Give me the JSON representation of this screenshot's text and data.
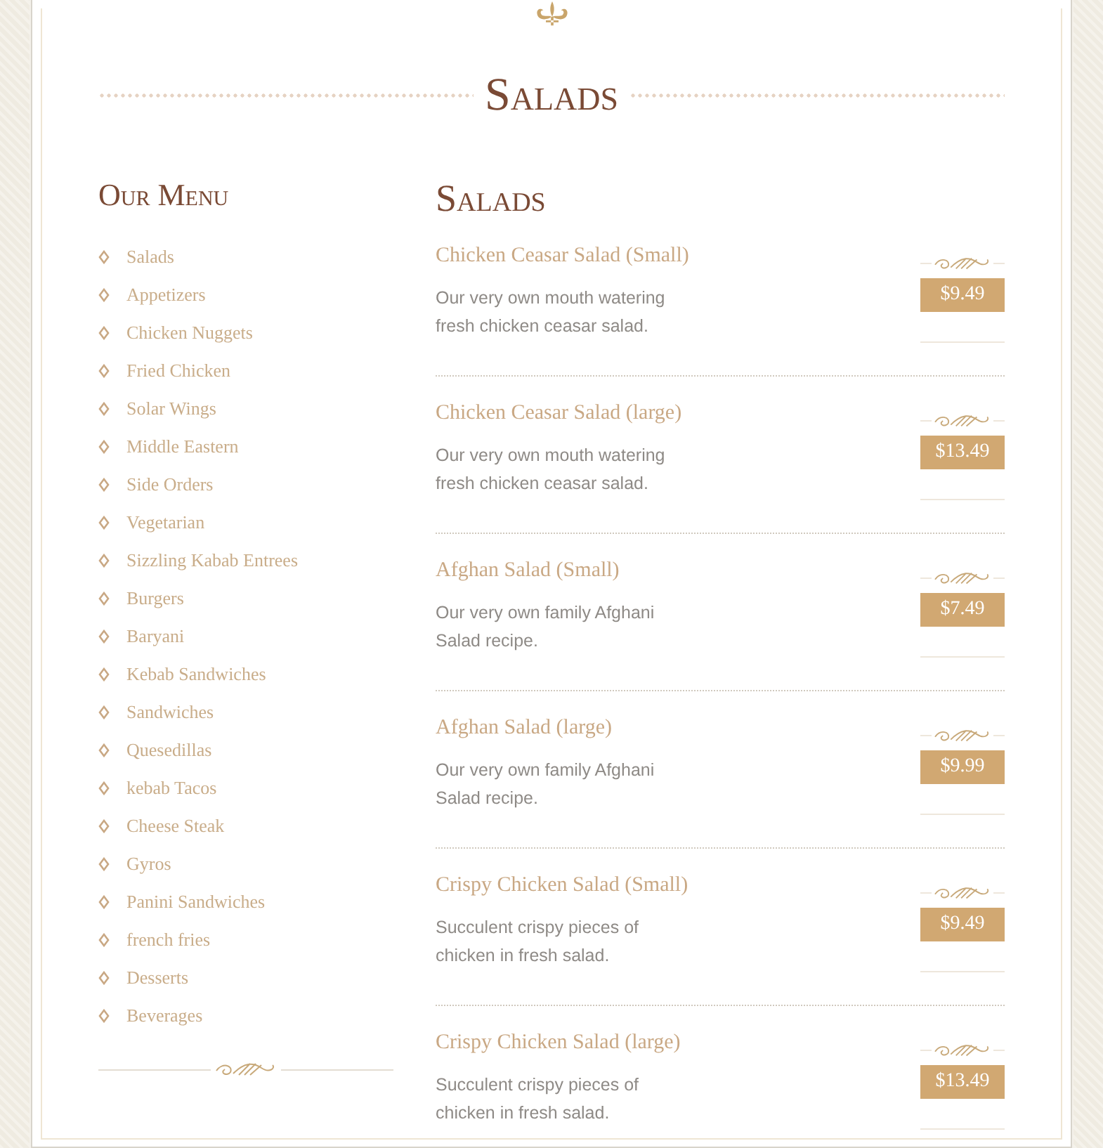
{
  "page_title": "Salads",
  "sidebar": {
    "title": "Our Menu",
    "items": [
      {
        "label": "Salads"
      },
      {
        "label": "Appetizers"
      },
      {
        "label": "Chicken Nuggets"
      },
      {
        "label": "Fried Chicken"
      },
      {
        "label": "Solar Wings"
      },
      {
        "label": "Middle Eastern"
      },
      {
        "label": "Side Orders"
      },
      {
        "label": "Vegetarian"
      },
      {
        "label": "Sizzling Kabab Entrees"
      },
      {
        "label": "Burgers"
      },
      {
        "label": "Baryani"
      },
      {
        "label": "Kebab Sandwiches"
      },
      {
        "label": "Sandwiches"
      },
      {
        "label": "Quesedillas"
      },
      {
        "label": "kebab Tacos"
      },
      {
        "label": "Cheese Steak"
      },
      {
        "label": "Gyros"
      },
      {
        "label": "Panini Sandwiches"
      },
      {
        "label": "french fries"
      },
      {
        "label": "Desserts"
      },
      {
        "label": "Beverages"
      }
    ]
  },
  "section": {
    "title": "Salads",
    "items": [
      {
        "name": "Chicken Ceasar Salad (Small)",
        "description": "Our very own mouth watering fresh chicken ceasar salad.",
        "price": "$9.49"
      },
      {
        "name": "Chicken Ceasar Salad (large)",
        "description": "Our very own mouth watering fresh chicken ceasar salad.",
        "price": "$13.49"
      },
      {
        "name": "Afghan Salad (Small)",
        "description": "Our very own family Afghani Salad recipe.",
        "price": "$7.49"
      },
      {
        "name": "Afghan Salad (large)",
        "description": "Our very own family Afghani Salad recipe.",
        "price": "$9.99"
      },
      {
        "name": "Crispy Chicken Salad (Small)",
        "description": "Succulent crispy pieces of chicken in fresh salad.",
        "price": "$9.49"
      },
      {
        "name": "Crispy Chicken Salad (large)",
        "description": "Succulent crispy pieces of chicken in fresh salad.",
        "price": "$13.49"
      }
    ]
  }
}
